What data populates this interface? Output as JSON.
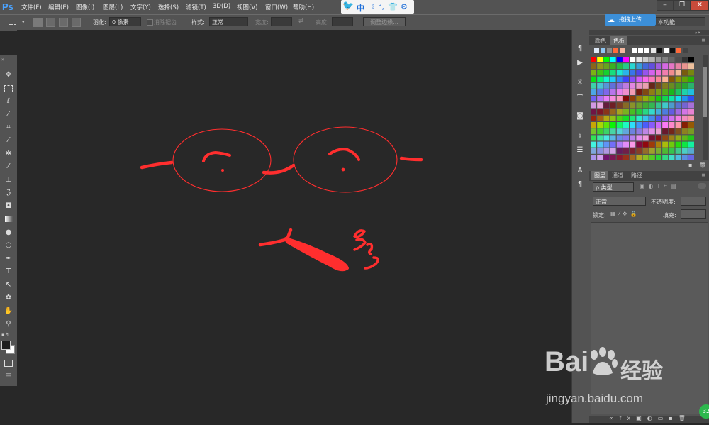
{
  "app": {
    "logo": "Ps"
  },
  "menu": {
    "items": [
      "文件(F)",
      "编辑(E)",
      "图像(I)",
      "图层(L)",
      "文字(Y)",
      "选择(S)",
      "滤镜(T)",
      "3D(D)",
      "视图(V)",
      "窗口(W)",
      "帮助(H)"
    ]
  },
  "ime": {
    "glyphs": [
      "中",
      "☽",
      "°,",
      "👕",
      "⚙"
    ]
  },
  "window": {
    "minimize": "‒",
    "restore": "❐",
    "close": "✕"
  },
  "options": {
    "feather_label": "羽化:",
    "feather_value": "0 像素",
    "antialias_label": "消除锯齿",
    "style_label": "样式:",
    "style_value": "正常",
    "width_label": "宽度:",
    "height_label": "高度:",
    "refine_label": "调整边缘...",
    "workspace_value": "本功能"
  },
  "upload": {
    "label": "拖拽上传"
  },
  "color_panel": {
    "tabs": [
      "颜色",
      "色板"
    ]
  },
  "layers_panel": {
    "tabs": [
      "图层",
      "通道",
      "路径"
    ],
    "filter_label": "ρ 类型",
    "blend_mode": "正常",
    "opacity_label": "不透明度:",
    "lock_label": "锁定:",
    "fill_label": "填充:"
  },
  "watermark": {
    "logo": "Bai",
    "logo_suffix": "经验",
    "url": "jingyan.baidu.com"
  },
  "badge": {
    "count": "32"
  },
  "colors": {
    "accent_red": "#ff2e2e",
    "ui_gray": "#535353",
    "canvas": "#282828",
    "ps_blue": "#4ba3ff"
  },
  "tools": [
    "move-icon",
    "marquee-icon",
    "lasso-icon",
    "quick-select-icon",
    "crop-icon",
    "eyedropper-icon",
    "healing-icon",
    "brush-icon",
    "stamp-icon",
    "history-brush-icon",
    "eraser-icon",
    "gradient-icon",
    "blur-icon",
    "dodge-icon",
    "pen-icon",
    "type-icon",
    "path-select-icon",
    "shape-icon",
    "hand-icon",
    "zoom-icon"
  ],
  "dock_icons": [
    "play-icon",
    "sun-icon",
    "levels-icon",
    "adjust-icon",
    "brush-preset-icon",
    "sliders-icon",
    "character-icon",
    "paragraph-icon"
  ]
}
